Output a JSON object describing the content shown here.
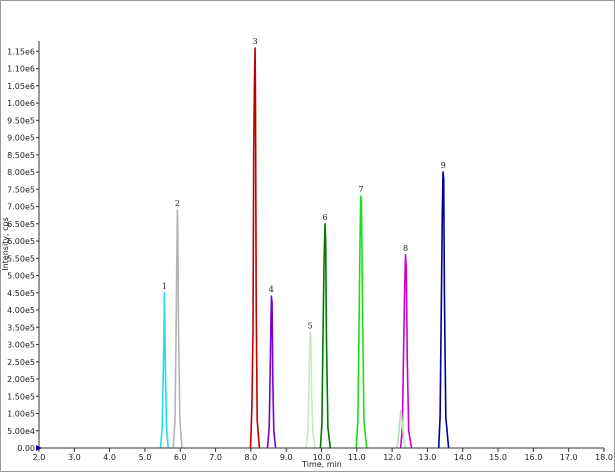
{
  "chart_data": {
    "type": "line",
    "xlabel": "Time, min",
    "ylabel": "Intensity, cps",
    "xlim": [
      2.0,
      18.0
    ],
    "ylim": [
      0,
      1180000
    ],
    "x_ticks": [
      2.0,
      3.0,
      4.0,
      5.0,
      6.0,
      7.0,
      8.0,
      9.0,
      10.0,
      11.0,
      12.0,
      13.0,
      14.0,
      15.0,
      16.0,
      17.0,
      18.0
    ],
    "x_tick_labels": [
      "2.0",
      "3.0",
      "4.0",
      "5.0",
      "6.0",
      "7.0",
      "8.0",
      "9.0",
      "10.0",
      "11.0",
      "12.0",
      "13.0",
      "14.0",
      "15.0",
      "16.0",
      "17.0",
      "18.0"
    ],
    "y_ticks": [
      0,
      50000,
      100000,
      150000,
      200000,
      250000,
      300000,
      350000,
      400000,
      450000,
      500000,
      550000,
      600000,
      650000,
      700000,
      750000,
      800000,
      850000,
      900000,
      950000,
      1000000,
      1050000,
      1100000,
      1150000
    ],
    "y_tick_labels": [
      "0.00",
      "5.00e4",
      "1.00e5",
      "1.50e5",
      "2.00e5",
      "2.50e5",
      "3.00e5",
      "3.50e5",
      "4.00e5",
      "4.50e5",
      "5.00e5",
      "5.50e5",
      "6.00e5",
      "6.50e5",
      "7.00e5",
      "7.50e5",
      "8.00e5",
      "8.50e5",
      "9.00e5",
      "9.50e5",
      "1.00e6",
      "1.05e6",
      "1.10e6",
      "1.15e6"
    ],
    "grid": false,
    "series": [
      {
        "color": "#1fe0ee",
        "peak_label": "1",
        "apex_x": 5.55,
        "apex_y": 450000,
        "x": [
          5.44,
          5.49,
          5.52,
          5.54,
          5.55,
          5.56,
          5.58,
          5.61,
          5.66
        ],
        "y": [
          0,
          60000,
          220000,
          330000,
          450000,
          400000,
          230000,
          60000,
          0
        ]
      },
      {
        "color": "#b4b4b4",
        "peak_label": "2",
        "apex_x": 5.92,
        "apex_y": 690000,
        "x": [
          5.8,
          5.85,
          5.88,
          5.9,
          5.92,
          5.93,
          5.95,
          5.99,
          6.05
        ],
        "y": [
          0,
          80000,
          320000,
          520000,
          690000,
          640000,
          350000,
          80000,
          0
        ]
      },
      {
        "color": "#c00000",
        "peak_label": "3",
        "apex_x": 8.12,
        "apex_y": 1160000,
        "x": [
          7.99,
          8.03,
          8.06,
          8.08,
          8.1,
          8.12,
          8.13,
          8.15,
          8.18,
          8.24
        ],
        "y": [
          0,
          120000,
          340000,
          850000,
          1050000,
          1160000,
          1000000,
          420000,
          80000,
          0
        ]
      },
      {
        "color": "#7a00d6",
        "peak_label": "4",
        "apex_x": 8.58,
        "apex_y": 440000,
        "x": [
          8.47,
          8.52,
          8.55,
          8.57,
          8.58,
          8.6,
          8.62,
          8.65,
          8.7
        ],
        "y": [
          0,
          60000,
          240000,
          380000,
          440000,
          420000,
          200000,
          50000,
          0
        ]
      },
      {
        "color": "#c8e8c8",
        "peak_label": "5",
        "apex_x": 9.68,
        "apex_y": 335000,
        "x": [
          9.56,
          9.61,
          9.64,
          9.66,
          9.68,
          9.7,
          9.72,
          9.76,
          9.82
        ],
        "y": [
          0,
          40000,
          150000,
          270000,
          335000,
          320000,
          160000,
          40000,
          0
        ]
      },
      {
        "color": "#007a00",
        "peak_label": "6",
        "apex_x": 10.1,
        "apex_y": 650000,
        "x": [
          9.97,
          10.01,
          10.04,
          10.07,
          10.1,
          10.12,
          10.14,
          10.18,
          10.25
        ],
        "y": [
          0,
          70000,
          300000,
          530000,
          650000,
          600000,
          330000,
          60000,
          0
        ]
      },
      {
        "color": "#18e018",
        "peak_label": "7",
        "apex_x": 11.12,
        "apex_y": 730000,
        "x": [
          10.98,
          11.03,
          11.06,
          11.09,
          11.11,
          11.13,
          11.16,
          11.2,
          11.28
        ],
        "y": [
          0,
          80000,
          320000,
          600000,
          730000,
          720000,
          420000,
          80000,
          0
        ]
      },
      {
        "color": "#d000d0",
        "peak_label": "8",
        "apex_x": 12.38,
        "apex_y": 560000,
        "x": [
          12.24,
          12.29,
          12.32,
          12.35,
          12.38,
          12.4,
          12.43,
          12.47,
          12.55
        ],
        "y": [
          0,
          60000,
          250000,
          440000,
          560000,
          520000,
          250000,
          50000,
          0
        ]
      },
      {
        "color": "#b8e0b8",
        "peak_label": "",
        "apex_x": 12.25,
        "apex_y": 110000,
        "x": [
          12.12,
          12.17,
          12.21,
          12.25,
          12.29,
          12.33,
          12.38
        ],
        "y": [
          0,
          20000,
          70000,
          110000,
          70000,
          20000,
          0
        ]
      },
      {
        "color": "#00009a",
        "peak_label": "9",
        "apex_x": 13.45,
        "apex_y": 800000,
        "x": [
          13.32,
          13.36,
          13.39,
          13.42,
          13.44,
          13.46,
          13.48,
          13.52,
          13.6
        ],
        "y": [
          0,
          90000,
          380000,
          680000,
          800000,
          780000,
          450000,
          90000,
          0
        ]
      }
    ]
  }
}
